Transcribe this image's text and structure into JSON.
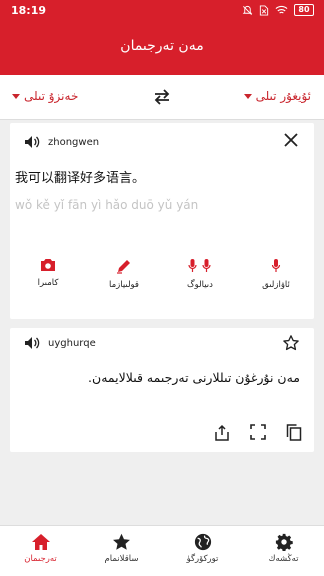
{
  "status": {
    "time": "18:19",
    "battery": "80"
  },
  "header": {
    "title": "مەن تەرجىمان"
  },
  "languages": {
    "source": {
      "label": "خەنزۇ تىلى"
    },
    "target": {
      "label": "ئۇيغۇر تىلى"
    }
  },
  "source_panel": {
    "lang_code": "zhongwen",
    "text": "我可以翻译好多语言。",
    "pinyin": "wǒ kě yǐ fān yì hǎo duō yǔ yán",
    "actions": [
      {
        "label": "كامىرا",
        "icon": "camera-icon"
      },
      {
        "label": "قولىيازما",
        "icon": "pen-icon"
      },
      {
        "label": "دىيالوگ",
        "icon": "dialog-mic-icon"
      },
      {
        "label": "ئاۋازلىق",
        "icon": "mic-icon"
      }
    ]
  },
  "result_panel": {
    "lang_code": "uyghurqe",
    "text": "مەن نۇرغۇن تىللارنى تەرجىمە قىلالايمەن."
  },
  "bottom_nav": [
    {
      "label": "تەرجىمان",
      "icon": "home-icon",
      "active": true
    },
    {
      "label": "ساقلانمام",
      "icon": "star-icon",
      "active": false
    },
    {
      "label": "توركۆرگۈ",
      "icon": "globe-icon",
      "active": false
    },
    {
      "label": "تەڭشەك",
      "icon": "gear-icon",
      "active": false
    }
  ],
  "colors": {
    "brand": "#d71f2b",
    "accent_text": "#c9252d"
  }
}
